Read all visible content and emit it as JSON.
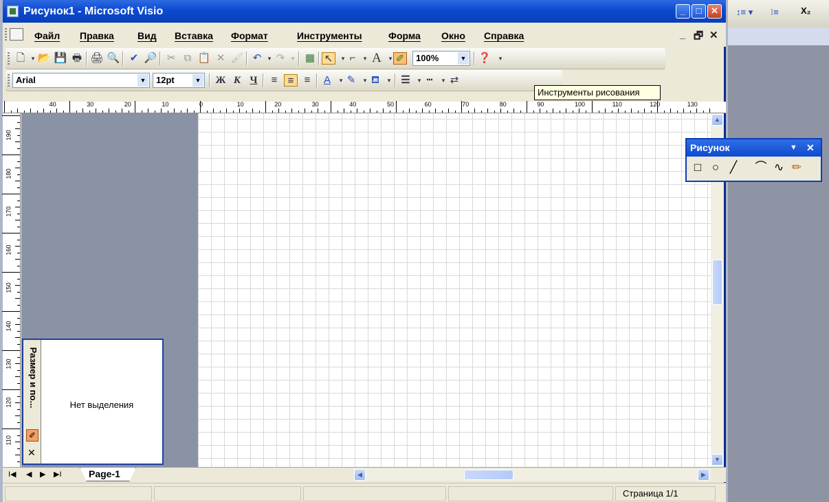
{
  "window": {
    "title": "Рисунок1 - Microsoft Visio"
  },
  "menu": {
    "items": [
      "Файл",
      "Правка",
      "Вид",
      "Вставка",
      "Формат",
      "Инструменты",
      "Форма",
      "Окно",
      "Справка"
    ]
  },
  "toolbar": {
    "zoom": "100%"
  },
  "format_toolbar": {
    "font": "Arial",
    "size": "12pt",
    "bold": "Ж",
    "italic": "К",
    "underline": "Ч",
    "tooltip": "Инструменты рисования"
  },
  "ruler": {
    "h_labels": [
      "40",
      "30",
      "20",
      "10",
      "0",
      "10",
      "20",
      "30",
      "40",
      "50",
      "60",
      "70",
      "80",
      "90",
      "100",
      "110",
      "120",
      "130"
    ],
    "v_labels": [
      "190",
      "180",
      "170",
      "160",
      "150",
      "140",
      "130",
      "120",
      "110"
    ]
  },
  "size_panel": {
    "title": "Размер и по...",
    "message": "Нет выделения"
  },
  "tabs": {
    "page": "Page-1"
  },
  "status": {
    "page": "Страница 1/1"
  },
  "draw_panel": {
    "title": "Рисунок"
  },
  "right_toolbar": {
    "items": [
      "↕≡ ▾",
      "⁝≡",
      "X₂"
    ]
  }
}
